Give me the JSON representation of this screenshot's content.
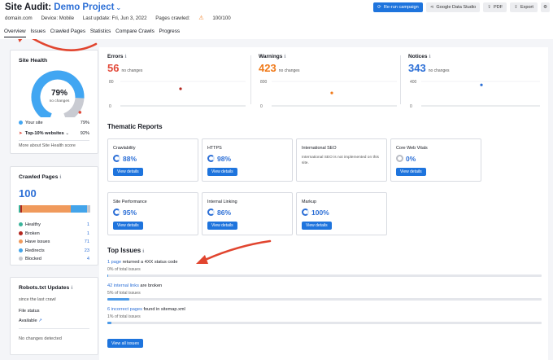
{
  "header": {
    "title_prefix": "Site Audit:",
    "project_name": "Demo Project",
    "domain": "domain.com",
    "device": "Device: Mobile",
    "last_update": "Last update: Fri, Jun 3, 2022",
    "pages_crawled_label": "Pages crawled:",
    "pages_crawled_value": "100/100",
    "actions": {
      "rerun": "Re-run campaign",
      "gds": "Google Data Studio",
      "pdf": "PDF",
      "export": "Export"
    }
  },
  "tabs": [
    "Overview",
    "Issues",
    "Crawled Pages",
    "Statistics",
    "Compare Crawls",
    "Progress"
  ],
  "site_health": {
    "title": "Site Health",
    "score": "79%",
    "score_sub": "no changes",
    "your_site_label": "Your site",
    "your_site_value": "79%",
    "top10_label": "Top-10% websites",
    "top10_value": "92%",
    "more_link": "More about Site Health score",
    "score_fraction": 0.79,
    "top10_fraction": 0.92,
    "colors": {
      "your_site": "#41a6f2",
      "top10": "#e24a3a",
      "rest": "#c9cbd2"
    }
  },
  "crawled_pages": {
    "title": "Crawled Pages",
    "total": "100",
    "rows": [
      {
        "label": "Healthy",
        "value": "1",
        "color": "#3ab39a",
        "count": 1
      },
      {
        "label": "Broken",
        "value": "1",
        "color": "#b3261e",
        "count": 1
      },
      {
        "label": "Have issues",
        "value": "71",
        "color": "#f09a5c",
        "count": 71
      },
      {
        "label": "Redirects",
        "value": "23",
        "color": "#43a4ea",
        "count": 23
      },
      {
        "label": "Blocked",
        "value": "4",
        "color": "#c6c8ce",
        "count": 4
      }
    ]
  },
  "robots": {
    "title": "Robots.txt Updates",
    "since": "since the last crawl",
    "file_status_label": "File status",
    "file_status_value": "Available",
    "changes": "No changes detected"
  },
  "metrics": [
    {
      "label": "Errors",
      "value": "56",
      "sub": "no changes",
      "color": "#e24a3a",
      "ticks": [
        "80",
        "0"
      ],
      "point": 56,
      "ymax": 80,
      "point_color": "#b3261e"
    },
    {
      "label": "Warnings",
      "value": "423",
      "sub": "no changes",
      "color": "#f07a1a",
      "ticks": [
        "800",
        "0"
      ],
      "point": 423,
      "ymax": 800,
      "point_color": "#f07a1a"
    },
    {
      "label": "Notices",
      "value": "343",
      "sub": "no changes",
      "color": "#2c6fd6",
      "ticks": [
        "400",
        "0"
      ],
      "point": 343,
      "ymax": 400,
      "point_color": "#2c6fd6"
    }
  ],
  "thematic": {
    "title": "Thematic Reports",
    "view_details": "View details",
    "cards": [
      {
        "name": "Crawlability",
        "value": "88%"
      },
      {
        "name": "HTTPS",
        "value": "98%"
      },
      {
        "name": "International SEO",
        "note": "International SEO is not implemented on this site."
      },
      {
        "name": "Core Web Vitals",
        "value": "0%"
      },
      {
        "name": "Site Performance",
        "value": "95%"
      },
      {
        "name": "Internal Linking",
        "value": "86%"
      },
      {
        "name": "Markup",
        "value": "100%"
      }
    ]
  },
  "top_issues": {
    "title": "Top Issues",
    "items": [
      {
        "link": "1 page",
        "rest": " returned a 4XX status code",
        "sub": "0% of total issues",
        "fraction": 0.0
      },
      {
        "link": "42 internal links",
        "rest": " are broken",
        "sub": "5% of total issues",
        "fraction": 0.05
      },
      {
        "link": "6 incorrect pages",
        "rest": " found in sitemap.xml",
        "sub": "1% of total issues",
        "fraction": 0.01
      }
    ],
    "view_all": "View all issues"
  }
}
